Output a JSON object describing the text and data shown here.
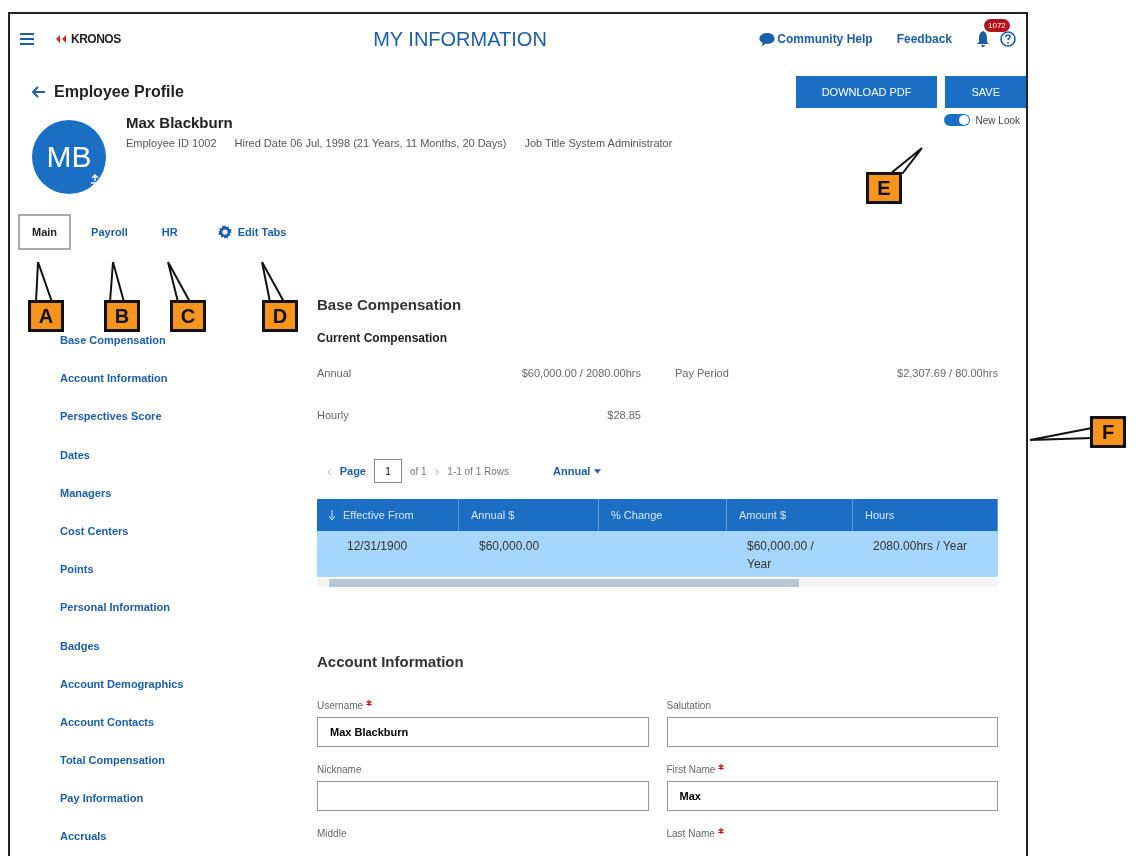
{
  "header": {
    "logo": "KRONOS",
    "title": "MY INFORMATION",
    "links": [
      "Community Help",
      "Feedback"
    ],
    "notification_count": "1072"
  },
  "page": {
    "back_title": "Employee Profile",
    "buttons": [
      "DOWNLOAD PDF",
      "SAVE"
    ]
  },
  "employee": {
    "initials": "MB",
    "name": "Max Blackburn",
    "details": [
      "Employee ID  1002",
      "Hired Date  06 Jul, 1998 (21 Years, 11 Months, 20 Days)",
      "Job Title  System Administrator"
    ]
  },
  "new_look": {
    "label": "New Look",
    "on": true
  },
  "tabs": [
    {
      "label": "Main",
      "selected": true
    },
    {
      "label": "Payroll",
      "selected": false
    },
    {
      "label": "HR",
      "selected": false
    }
  ],
  "edit_tabs": "Edit Tabs",
  "sidebar": {
    "items": [
      "Base Compensation",
      "Account Information",
      "Perspectives Score",
      "Dates",
      "Managers",
      "Cost Centers",
      "Points",
      "Personal Information",
      "Badges",
      "Account Demographics",
      "Account Contacts",
      "Total Compensation",
      "Pay Information",
      "Accruals"
    ]
  },
  "base_compensation": {
    "title": "Base Compensation",
    "subtitle": "Current Compensation",
    "rows": [
      {
        "label": "Annual",
        "value": "$60,000.00 / 2080.00hrs",
        "label_2": "Pay Period",
        "value_2": "$2,307.69 / 80.00hrs"
      },
      {
        "label": "Hourly",
        "value": "$28.85"
      }
    ],
    "pager": {
      "prev": "‹",
      "next": "›",
      "page_label": "Page",
      "page": "1",
      "of": "of 1",
      "rows": "1-1 of 1 Rows",
      "period": "Annual"
    },
    "table": {
      "columns": [
        "Effective From",
        "Annual $",
        "% Change",
        "Amount $",
        "Hours"
      ],
      "rows": [
        {
          "selected": true,
          "cells": [
            "12/31/1900",
            "$60,000.00",
            "",
            "$60,000.00 / Year",
            "2080.00hrs / Year"
          ]
        }
      ]
    }
  },
  "account_information": {
    "title": "Account Information",
    "fields": [
      {
        "kind": "input",
        "label": "Username",
        "required": true,
        "value": "Max Blackburn"
      },
      {
        "kind": "input",
        "label": "Salutation",
        "required": false
      },
      {
        "kind": "input",
        "label": "Nickname",
        "required": false
      },
      {
        "kind": "input",
        "label": "First Name",
        "required": true,
        "value": "Max"
      },
      {
        "kind": "label",
        "label": "Middle",
        "required": false
      },
      {
        "kind": "label",
        "label": "Last Name",
        "required": true
      }
    ]
  },
  "callouts": [
    "A",
    "B",
    "C",
    "D",
    "E",
    "F"
  ]
}
